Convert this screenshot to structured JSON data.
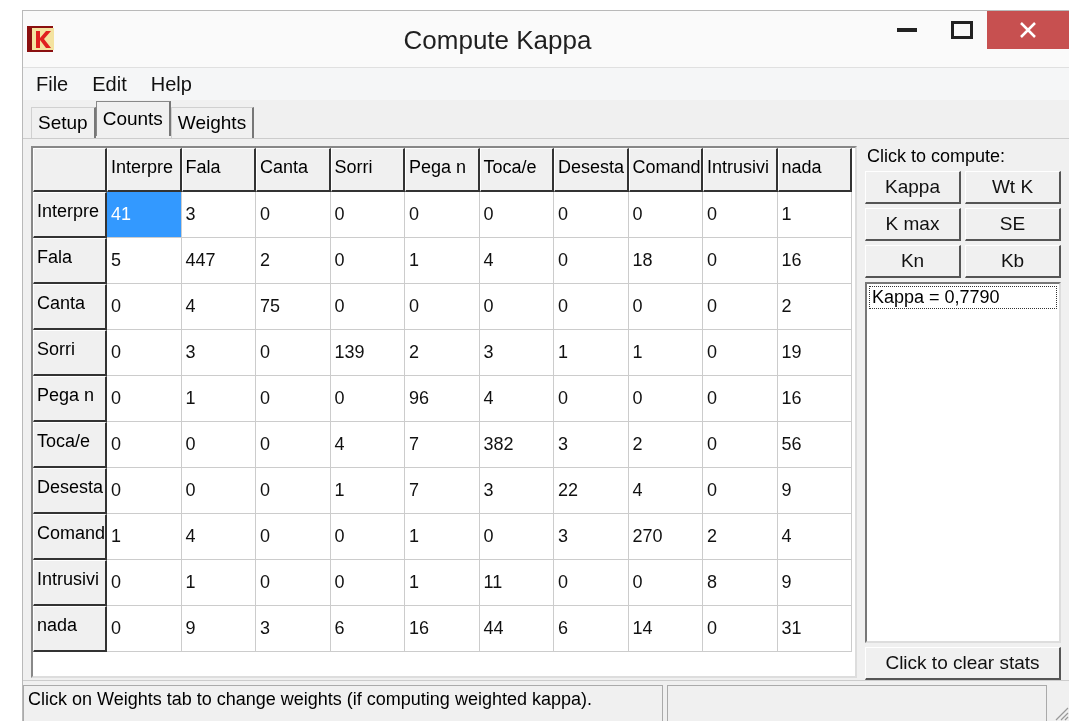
{
  "window": {
    "title": "Compute Kappa"
  },
  "menu": [
    "File",
    "Edit",
    "Help"
  ],
  "tabs": [
    {
      "label": "Setup",
      "selected": false
    },
    {
      "label": "Counts",
      "selected": true
    },
    {
      "label": "Weights",
      "selected": false
    }
  ],
  "grid": {
    "columns": [
      "Interpre",
      "Fala",
      "Canta",
      "Sorri",
      "Pega n",
      "Toca/e",
      "Desesta",
      "Comand",
      "Intrusivi",
      "nada"
    ],
    "rows": [
      {
        "header": "Interpre",
        "cells": [
          {
            "value": "41",
            "selected": true
          },
          {
            "value": "3",
            "selected": false
          },
          {
            "value": "0",
            "selected": false
          },
          {
            "value": "0",
            "selected": false
          },
          {
            "value": "0",
            "selected": false
          },
          {
            "value": "0",
            "selected": false
          },
          {
            "value": "0",
            "selected": false
          },
          {
            "value": "0",
            "selected": false
          },
          {
            "value": "0",
            "selected": false
          },
          {
            "value": "1",
            "selected": false
          }
        ]
      },
      {
        "header": "Fala",
        "cells": [
          {
            "value": "5",
            "selected": false
          },
          {
            "value": "447",
            "selected": false
          },
          {
            "value": "2",
            "selected": false
          },
          {
            "value": "0",
            "selected": false
          },
          {
            "value": "1",
            "selected": false
          },
          {
            "value": "4",
            "selected": false
          },
          {
            "value": "0",
            "selected": false
          },
          {
            "value": "18",
            "selected": false
          },
          {
            "value": "0",
            "selected": false
          },
          {
            "value": "16",
            "selected": false
          }
        ]
      },
      {
        "header": "Canta",
        "cells": [
          {
            "value": "0",
            "selected": false
          },
          {
            "value": "4",
            "selected": false
          },
          {
            "value": "75",
            "selected": false
          },
          {
            "value": "0",
            "selected": false
          },
          {
            "value": "0",
            "selected": false
          },
          {
            "value": "0",
            "selected": false
          },
          {
            "value": "0",
            "selected": false
          },
          {
            "value": "0",
            "selected": false
          },
          {
            "value": "0",
            "selected": false
          },
          {
            "value": "2",
            "selected": false
          }
        ]
      },
      {
        "header": "Sorri",
        "cells": [
          {
            "value": "0",
            "selected": false
          },
          {
            "value": "3",
            "selected": false
          },
          {
            "value": "0",
            "selected": false
          },
          {
            "value": "139",
            "selected": false
          },
          {
            "value": "2",
            "selected": false
          },
          {
            "value": "3",
            "selected": false
          },
          {
            "value": "1",
            "selected": false
          },
          {
            "value": "1",
            "selected": false
          },
          {
            "value": "0",
            "selected": false
          },
          {
            "value": "19",
            "selected": false
          }
        ]
      },
      {
        "header": "Pega n",
        "cells": [
          {
            "value": "0",
            "selected": false
          },
          {
            "value": "1",
            "selected": false
          },
          {
            "value": "0",
            "selected": false
          },
          {
            "value": "0",
            "selected": false
          },
          {
            "value": "96",
            "selected": false
          },
          {
            "value": "4",
            "selected": false
          },
          {
            "value": "0",
            "selected": false
          },
          {
            "value": "0",
            "selected": false
          },
          {
            "value": "0",
            "selected": false
          },
          {
            "value": "16",
            "selected": false
          }
        ]
      },
      {
        "header": "Toca/e",
        "cells": [
          {
            "value": "0",
            "selected": false
          },
          {
            "value": "0",
            "selected": false
          },
          {
            "value": "0",
            "selected": false
          },
          {
            "value": "4",
            "selected": false
          },
          {
            "value": "7",
            "selected": false
          },
          {
            "value": "382",
            "selected": false
          },
          {
            "value": "3",
            "selected": false
          },
          {
            "value": "2",
            "selected": false
          },
          {
            "value": "0",
            "selected": false
          },
          {
            "value": "56",
            "selected": false
          }
        ]
      },
      {
        "header": "Desesta",
        "cells": [
          {
            "value": "0",
            "selected": false
          },
          {
            "value": "0",
            "selected": false
          },
          {
            "value": "0",
            "selected": false
          },
          {
            "value": "1",
            "selected": false
          },
          {
            "value": "7",
            "selected": false
          },
          {
            "value": "3",
            "selected": false
          },
          {
            "value": "22",
            "selected": false
          },
          {
            "value": "4",
            "selected": false
          },
          {
            "value": "0",
            "selected": false
          },
          {
            "value": "9",
            "selected": false
          }
        ]
      },
      {
        "header": "Comand",
        "cells": [
          {
            "value": "1",
            "selected": false
          },
          {
            "value": "4",
            "selected": false
          },
          {
            "value": "0",
            "selected": false
          },
          {
            "value": "0",
            "selected": false
          },
          {
            "value": "1",
            "selected": false
          },
          {
            "value": "0",
            "selected": false
          },
          {
            "value": "3",
            "selected": false
          },
          {
            "value": "270",
            "selected": false
          },
          {
            "value": "2",
            "selected": false
          },
          {
            "value": "4",
            "selected": false
          }
        ]
      },
      {
        "header": "Intrusivi",
        "cells": [
          {
            "value": "0",
            "selected": false
          },
          {
            "value": "1",
            "selected": false
          },
          {
            "value": "0",
            "selected": false
          },
          {
            "value": "0",
            "selected": false
          },
          {
            "value": "1",
            "selected": false
          },
          {
            "value": "11",
            "selected": false
          },
          {
            "value": "0",
            "selected": false
          },
          {
            "value": "0",
            "selected": false
          },
          {
            "value": "8",
            "selected": false
          },
          {
            "value": "9",
            "selected": false
          }
        ]
      },
      {
        "header": "nada",
        "cells": [
          {
            "value": "0",
            "selected": false
          },
          {
            "value": "9",
            "selected": false
          },
          {
            "value": "3",
            "selected": false
          },
          {
            "value": "6",
            "selected": false
          },
          {
            "value": "16",
            "selected": false
          },
          {
            "value": "44",
            "selected": false
          },
          {
            "value": "6",
            "selected": false
          },
          {
            "value": "14",
            "selected": false
          },
          {
            "value": "0",
            "selected": false
          },
          {
            "value": "31",
            "selected": false
          }
        ]
      }
    ]
  },
  "compute": {
    "label": "Click to compute:",
    "buttons": [
      "Kappa",
      "Wt K",
      "K max",
      "SE",
      "Kn",
      "Kb"
    ]
  },
  "results": [
    {
      "text": "Kappa = 0,7790",
      "focused": true
    }
  ],
  "clear_button": "Click to clear stats",
  "status_bar": "Click on Weights tab to change weights (if computing weighted kappa)."
}
